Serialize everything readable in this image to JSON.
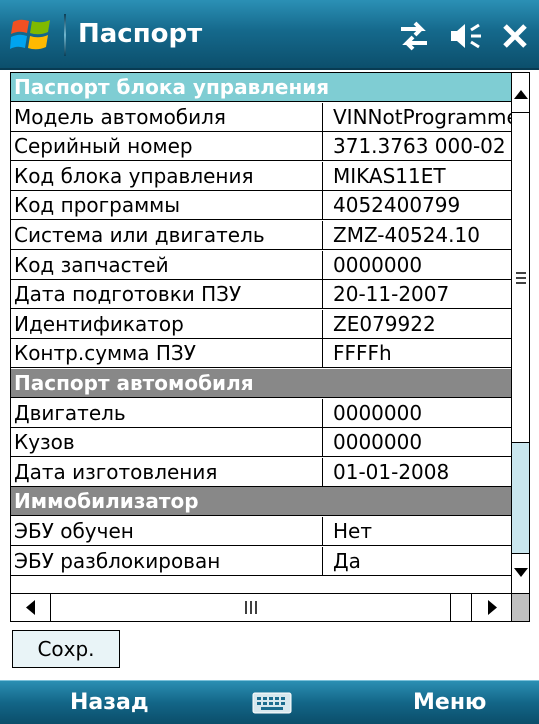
{
  "title_bar": {
    "title": "Паспорт",
    "icons": [
      "windows-start-icon",
      "connectivity-icon",
      "volume-icon",
      "close-icon"
    ]
  },
  "grid": {
    "rows": [
      {
        "type": "header",
        "style": "teal",
        "label": "Паспорт блока управления"
      },
      {
        "type": "field",
        "label": "Модель автомобиля",
        "value": "VINNotProgrammed"
      },
      {
        "type": "field",
        "label": "Серийный номер",
        "value": "371.3763 000-02"
      },
      {
        "type": "field",
        "label": "Код блока управления",
        "value": "MIKAS11ET"
      },
      {
        "type": "field",
        "label": "Код программы",
        "value": "4052400799"
      },
      {
        "type": "field",
        "label": "Система или двигатель",
        "value": "ZMZ-40524.10"
      },
      {
        "type": "field",
        "label": "Код запчастей",
        "value": "0000000"
      },
      {
        "type": "field",
        "label": "Дата подготовки ПЗУ",
        "value": "20-11-2007"
      },
      {
        "type": "field",
        "label": "Идентификатор",
        "value": "ZE079922"
      },
      {
        "type": "field",
        "label": "Контр.сумма ПЗУ",
        "value": "FFFFh"
      },
      {
        "type": "header",
        "style": "gray",
        "label": "Паспорт автомобиля"
      },
      {
        "type": "field",
        "label": "Двигатель",
        "value": "0000000"
      },
      {
        "type": "field",
        "label": "Кузов",
        "value": "0000000"
      },
      {
        "type": "field",
        "label": "Дата изготовления",
        "value": "01-01-2008"
      },
      {
        "type": "header",
        "style": "gray",
        "label": "Иммобилизатор"
      },
      {
        "type": "field",
        "label": "ЭБУ обучен",
        "value": "Нет"
      },
      {
        "type": "field",
        "label": "ЭБУ разблокирован",
        "value": "Да"
      }
    ]
  },
  "buttons": {
    "save_label": "Сохр."
  },
  "menu_bar": {
    "left_label": "Назад",
    "right_label": "Меню",
    "center_icon": "keyboard-icon"
  },
  "colors": {
    "title_bar": "#15698c",
    "header_teal": "#7fcdd3",
    "header_gray": "#888888",
    "scroll_track": "#c9e6ee"
  }
}
